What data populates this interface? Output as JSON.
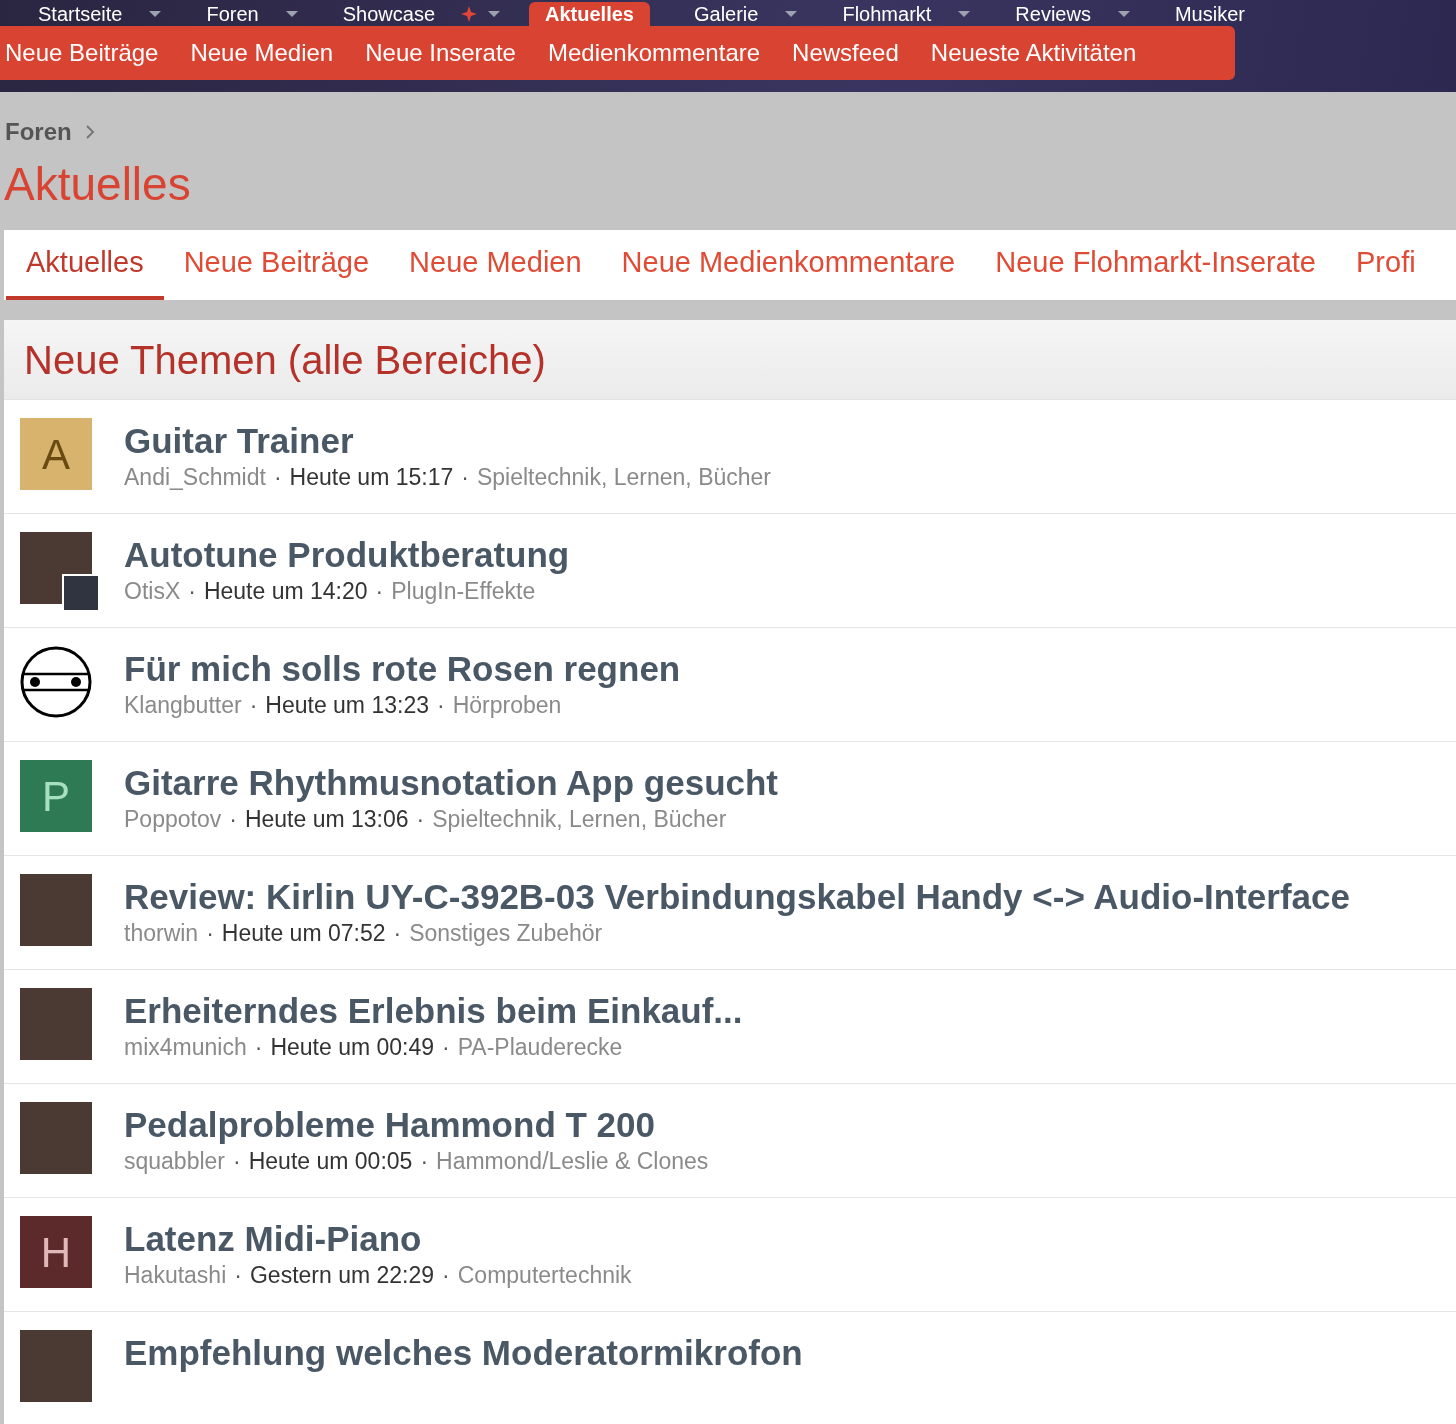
{
  "main_nav": [
    {
      "label": "Startseite",
      "selected": false,
      "has_menu": true,
      "new": false
    },
    {
      "label": "Foren",
      "selected": false,
      "has_menu": true,
      "new": false
    },
    {
      "label": "Showcase",
      "selected": false,
      "has_menu": true,
      "new": true
    },
    {
      "label": "Aktuelles",
      "selected": true,
      "has_menu": false,
      "new": false
    },
    {
      "label": "Galerie",
      "selected": false,
      "has_menu": true,
      "new": false
    },
    {
      "label": "Flohmarkt",
      "selected": false,
      "has_menu": true,
      "new": false
    },
    {
      "label": "Reviews",
      "selected": false,
      "has_menu": true,
      "new": false
    },
    {
      "label": "Musiker",
      "selected": false,
      "has_menu": false,
      "new": false
    }
  ],
  "sub_nav": [
    "Neue Beiträge",
    "Neue Medien",
    "Neue Inserate",
    "Medienkommentare",
    "Newsfeed",
    "Neueste Aktivitäten"
  ],
  "breadcrumb": [
    "Foren"
  ],
  "page_title": "Aktuelles",
  "tabs": [
    {
      "label": "Aktuelles",
      "selected": true
    },
    {
      "label": "Neue Beiträge",
      "selected": false
    },
    {
      "label": "Neue Medien",
      "selected": false
    },
    {
      "label": "Neue Medienkommentare",
      "selected": false
    },
    {
      "label": "Neue Flohmarkt-Inserate",
      "selected": false
    },
    {
      "label": "Profi",
      "selected": false
    }
  ],
  "section_title": "Neue Themen (alle Bereiche)",
  "threads": [
    {
      "title": "Guitar Trainer",
      "meta": [
        {
          "kind": "author",
          "text": "Andi_Schmidt"
        },
        {
          "kind": "separator",
          "text": "·"
        },
        {
          "kind": "time",
          "text": "Heute um 15:17"
        },
        {
          "kind": "separator",
          "text": "·"
        },
        {
          "kind": "forum",
          "text": "Spieltechnik, Lernen, Bücher"
        }
      ],
      "avatar": {
        "kind": "letter",
        "letter": "A",
        "color": "#d8b36e"
      }
    },
    {
      "title": "Autotune Produktberatung",
      "meta": [
        {
          "kind": "author",
          "text": "OtisX"
        },
        {
          "kind": "separator",
          "text": "·"
        },
        {
          "kind": "time",
          "text": "Heute um 14:20"
        },
        {
          "kind": "separator",
          "text": "·"
        },
        {
          "kind": "forum",
          "text": "PlugIn-Effekte"
        }
      ],
      "avatar": {
        "kind": "photo",
        "badge": true
      }
    },
    {
      "title": "Für mich solls rote Rosen regnen",
      "meta": [
        {
          "kind": "author",
          "text": "Klangbutter"
        },
        {
          "kind": "separator",
          "text": "·"
        },
        {
          "kind": "time",
          "text": "Heute um 13:23"
        },
        {
          "kind": "separator",
          "text": "·"
        },
        {
          "kind": "forum",
          "text": "Hörproben"
        }
      ],
      "avatar": {
        "kind": "emblem"
      }
    },
    {
      "title": "Gitarre Rhythmusnotation App gesucht",
      "meta": [
        {
          "kind": "author",
          "text": "Poppotov"
        },
        {
          "kind": "separator",
          "text": "·"
        },
        {
          "kind": "time",
          "text": "Heute um 13:06"
        },
        {
          "kind": "separator",
          "text": "·"
        },
        {
          "kind": "forum",
          "text": "Spieltechnik, Lernen, Bücher"
        }
      ],
      "avatar": {
        "kind": "letter",
        "letter": "P",
        "color": "#2e7a55"
      }
    },
    {
      "title": "Review: Kirlin UY-C-392B-03 Verbindungskabel Handy <-> Audio-Interface",
      "meta": [
        {
          "kind": "author",
          "text": "thorwin"
        },
        {
          "kind": "separator",
          "text": "·"
        },
        {
          "kind": "time",
          "text": "Heute um 07:52"
        },
        {
          "kind": "separator",
          "text": "·"
        },
        {
          "kind": "forum",
          "text": "Sonstiges Zubehör"
        }
      ],
      "avatar": {
        "kind": "photo",
        "badge": false
      }
    },
    {
      "title": "Erheiterndes Erlebnis beim Einkauf...",
      "meta": [
        {
          "kind": "author",
          "text": "mix4munich"
        },
        {
          "kind": "separator",
          "text": "·"
        },
        {
          "kind": "time",
          "text": "Heute um 00:49"
        },
        {
          "kind": "separator",
          "text": "·"
        },
        {
          "kind": "forum",
          "text": "PA-Plauderecke"
        }
      ],
      "avatar": {
        "kind": "photo",
        "badge": false
      }
    },
    {
      "title": "Pedalprobleme Hammond T 200",
      "meta": [
        {
          "kind": "author",
          "text": "squabbler"
        },
        {
          "kind": "separator",
          "text": "·"
        },
        {
          "kind": "time",
          "text": "Heute um 00:05"
        },
        {
          "kind": "separator",
          "text": "·"
        },
        {
          "kind": "forum",
          "text": "Hammond/Leslie & Clones"
        }
      ],
      "avatar": {
        "kind": "photo",
        "badge": false
      }
    },
    {
      "title": "Latenz Midi-Piano",
      "meta": [
        {
          "kind": "author",
          "text": "Hakutashi"
        },
        {
          "kind": "separator",
          "text": "·"
        },
        {
          "kind": "time",
          "text": "Gestern um 22:29"
        },
        {
          "kind": "separator",
          "text": "·"
        },
        {
          "kind": "forum",
          "text": "Computertechnik"
        }
      ],
      "avatar": {
        "kind": "letter",
        "letter": "H",
        "color": "#5c2a2a"
      }
    },
    {
      "title": "Empfehlung welches Moderatormikrofon",
      "avatar": {
        "kind": "photo",
        "badge": false
      }
    }
  ]
}
